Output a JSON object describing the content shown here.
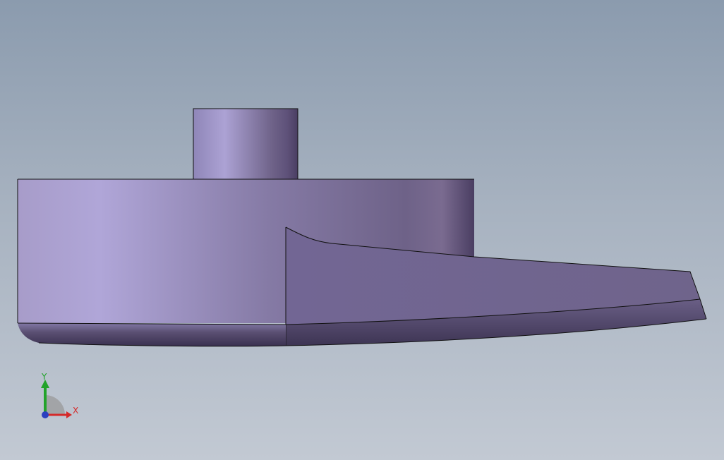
{
  "viewport": {
    "background_top": "#8b9bae",
    "background_bottom": "#c2c9d3"
  },
  "model": {
    "part_color": "#8a7fae",
    "part_highlight": "#b0a6d8",
    "part_shadow": "#4b3f63",
    "edge_color": "#111111"
  },
  "triad": {
    "x_label": "X",
    "y_label": "Y",
    "x_color": "#d42a2a",
    "y_color": "#22a32a",
    "z_color": "#2b3fbf"
  }
}
